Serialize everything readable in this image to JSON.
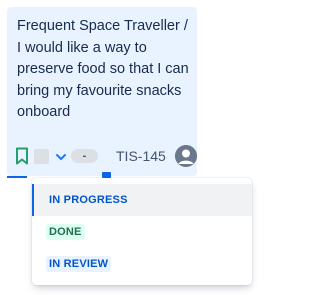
{
  "card": {
    "summary": "Frequent Space Traveller / I would like a way to preserve food so that I can bring my favourite snacks onboard",
    "estimate": "-",
    "issue_key": "TIS-145",
    "icons": {
      "bookmark": "bookmark-icon",
      "priority": "chevron-down-icon",
      "avatar": "user-avatar-icon"
    },
    "colors": {
      "background": "#e9f2ff",
      "bookmark": "#22a06b",
      "priority": "#1d7afc"
    }
  },
  "status_menu": {
    "items": [
      {
        "label": "IN PROGRESS",
        "selected": true
      },
      {
        "label": "DONE",
        "selected": false
      },
      {
        "label": "IN REVIEW",
        "selected": false
      }
    ],
    "colors": {
      "selected_indicator": "#0c66e4",
      "done_bg": "#dcfff1",
      "done_text": "#216e4e",
      "review_bg": "#e9f2ff",
      "review_text": "#0055cc"
    }
  }
}
